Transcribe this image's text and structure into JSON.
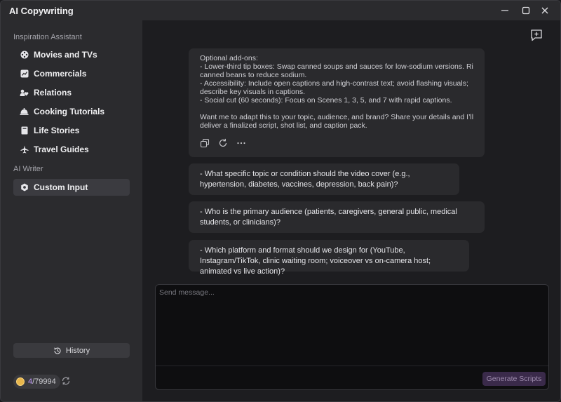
{
  "app": {
    "title": "AI Copywriting"
  },
  "sidebar": {
    "inspiration_label": "Inspiration Assistant",
    "items": [
      {
        "label": "Movies and TVs",
        "icon": "film-reel-icon"
      },
      {
        "label": "Commercials",
        "icon": "chart-icon"
      },
      {
        "label": "Relations",
        "icon": "heart-people-icon"
      },
      {
        "label": "Cooking Tutorials",
        "icon": "cloche-icon"
      },
      {
        "label": "Life Stories",
        "icon": "book-icon"
      },
      {
        "label": "Travel Guides",
        "icon": "airplane-icon"
      }
    ],
    "writer_label": "AI Writer",
    "custom_input": {
      "label": "Custom Input",
      "icon": "gear-icon"
    },
    "history_label": "History",
    "credits": {
      "used": "4",
      "total": "/79994"
    }
  },
  "chat": {
    "assistant_lines": [
      "Optional add-ons:",
      "- Lower-third tip boxes: Swap canned soups and sauces for low-sodium versions. Rinse",
      "canned beans to reduce sodium.",
      "- Accessibility: Include open captions and high-contrast text; avoid flashing visuals;",
      "describe key visuals in captions.",
      "- Social cut (60 seconds): Focus on Scenes 1, 3, 5, and 7 with rapid captions.",
      "",
      "Want me to adapt this to your topic, audience, and brand? Share your details and I’ll",
      "deliver a finalized script, shot list, and caption pack."
    ],
    "questions": [
      "- What specific topic or condition should the video cover (e.g., hypertension, diabetes, vaccines, depression, back pain)?",
      "- Who is the primary audience (patients, caregivers, general public, medical students, or clinicians)?",
      "- Which platform and format should we design for (YouTube, Instagram/TikTok, clinic waiting room; voiceover vs on-camera host; animated vs live action)?"
    ]
  },
  "composer": {
    "placeholder": "Send message...",
    "generate_label": "Generate Scripts"
  }
}
